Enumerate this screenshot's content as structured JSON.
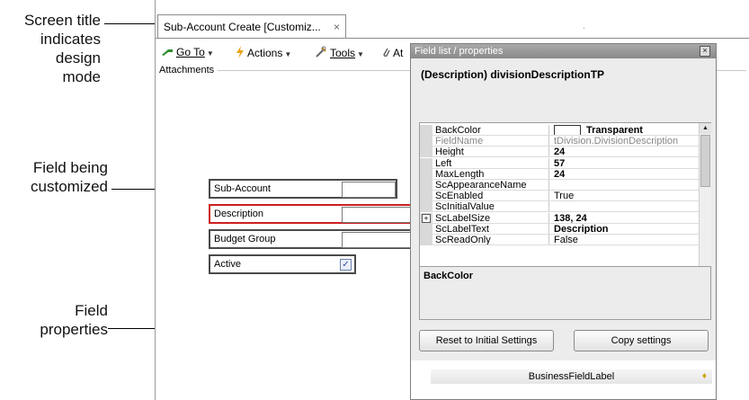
{
  "callouts": {
    "screen_title": [
      "Screen title",
      "indicates",
      "design",
      "mode"
    ],
    "field_customized": [
      "Field being",
      "customized"
    ],
    "field_properties": [
      "Field",
      "properties"
    ]
  },
  "window": {
    "tab_title": "Sub-Account Create [Customiz...",
    "tab_close": "×",
    "tab_dot": "."
  },
  "toolbar": {
    "goto_label": "Go To",
    "actions_label": "Actions",
    "tools_label": "Tools",
    "attach_label": "At"
  },
  "attachments_label": "Attachments",
  "form": {
    "fields": [
      {
        "label": "Sub-Account"
      },
      {
        "label": "Description"
      },
      {
        "label": "Budget Group"
      },
      {
        "label": "Active"
      }
    ],
    "active_checked": "✓"
  },
  "panel": {
    "title": "Field list / properties",
    "close": "×",
    "heading": "(Description) divisionDescriptionTP",
    "properties": [
      {
        "name": "BackColor",
        "value": "Transparent",
        "bold": true,
        "swatch": true
      },
      {
        "name": "FieldName",
        "value": "tDivision.DivisionDescription",
        "dim": true
      },
      {
        "name": "Height",
        "value": "24",
        "bold": true
      },
      {
        "name": "Left",
        "value": "57",
        "bold": true
      },
      {
        "name": "MaxLength",
        "value": "24",
        "bold": true
      },
      {
        "name": "ScAppearanceName",
        "value": ""
      },
      {
        "name": "ScEnabled",
        "value": "True"
      },
      {
        "name": "ScInitialValue",
        "value": ""
      },
      {
        "name": "ScLabelSize",
        "value": "138, 24",
        "bold": true,
        "expandable": true
      },
      {
        "name": "ScLabelText",
        "value": "Description",
        "bold": true
      },
      {
        "name": "ScReadOnly",
        "value": "False"
      }
    ],
    "description_title": "BackColor",
    "reset_button": "Reset to Initial Settings",
    "copy_button": "Copy settings",
    "business_field_label": "BusinessFieldLabel"
  },
  "colors": {
    "selected_field_border": "#cc1f1f",
    "panel_background": "#ececec",
    "goto_icon": "#2f8f2f",
    "actions_icon": "#e8a317"
  }
}
